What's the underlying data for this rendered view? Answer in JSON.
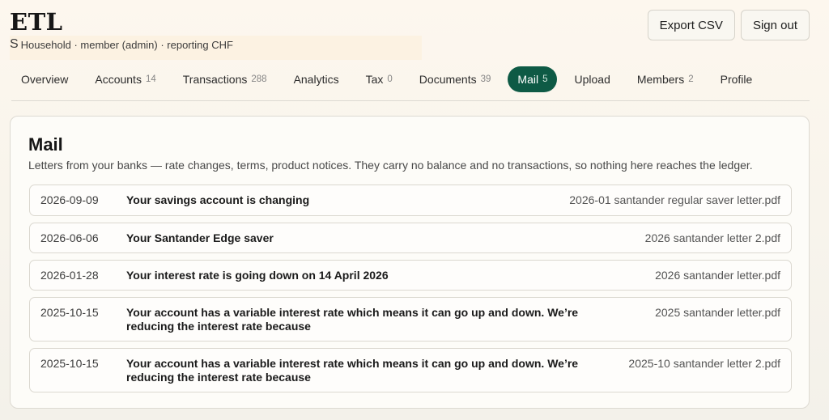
{
  "app": {
    "title": "ETL",
    "avatar_initial": "S",
    "subtitle": "Household · member (admin) · reporting CHF"
  },
  "actions": {
    "export_label": "Export CSV",
    "signout_label": "Sign out"
  },
  "nav": {
    "overview": {
      "label": "Overview",
      "count": ""
    },
    "accounts": {
      "label": "Accounts",
      "count": "14"
    },
    "transactions": {
      "label": "Transactions",
      "count": "288"
    },
    "analytics": {
      "label": "Analytics",
      "count": ""
    },
    "tax": {
      "label": "Tax",
      "count": "0"
    },
    "documents": {
      "label": "Documents",
      "count": "39"
    },
    "mail": {
      "label": "Mail",
      "count": "5",
      "active": true
    },
    "upload": {
      "label": "Upload",
      "count": ""
    },
    "members": {
      "label": "Members",
      "count": "2"
    },
    "profile": {
      "label": "Profile",
      "count": ""
    }
  },
  "mail_panel": {
    "title": "Mail",
    "description": "Letters from your banks — rate changes, terms, product notices. They carry no balance and no transactions, so nothing here reaches the ledger.",
    "items": [
      {
        "date": "2026-09-09",
        "subject": "Your savings account is changing",
        "file": "2026-01 santander regular saver letter.pdf"
      },
      {
        "date": "2026-06-06",
        "subject": "Your Santander Edge saver",
        "file": "2026 santander letter 2.pdf"
      },
      {
        "date": "2026-01-28",
        "subject": "Your interest rate is going down on 14 April 2026",
        "file": "2026 santander letter.pdf"
      },
      {
        "date": "2025-10-15",
        "subject": "Your account has a variable interest rate which means it can go up and down. We’re reducing the interest rate because",
        "file": "2025 santander letter.pdf"
      },
      {
        "date": "2025-10-15",
        "subject": "Your account has a variable interest rate which means it can go up and down. We’re reducing the interest rate because",
        "file": "2025-10 santander letter 2.pdf"
      }
    ]
  },
  "colors": {
    "accent": "#0e5a45",
    "background": "#f3f1ea",
    "card": "#fdfcf8"
  }
}
